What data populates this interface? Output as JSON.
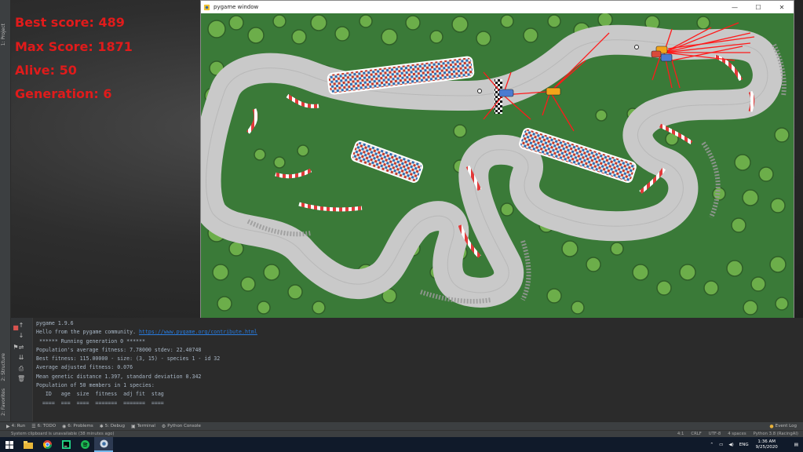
{
  "game_window": {
    "title": "pygame window",
    "minimize": "—",
    "maximize": "☐",
    "close": "✕"
  },
  "hud": {
    "best_score": "Best score: 489",
    "max_score": "Max Score: 1871",
    "alive": "Alive: 50",
    "generation": "Generation: 6"
  },
  "ide_left_tabs": [
    "1: Project",
    "2: Structure",
    "2: Favorites"
  ],
  "console": {
    "lines": [
      "pygame 1.9.6",
      "Hello from the pygame community. ",
      "",
      " ****** Running generation 0 ******",
      "",
      "Population's average fitness: 7.78000 stdev: 22.40748",
      "Best fitness: 115.00000 - size: (3, 15) - species 1 - id 32",
      "Average adjusted fitness: 0.076",
      "Mean genetic distance 1.397, standard deviation 0.342",
      "Population of 50 members in 1 species:",
      "   ID   age  size  fitness  adj fit  stag",
      "  ====  ===  ====  =======  =======  ===="
    ],
    "link": "https://www.pygame.org/contribute.html"
  },
  "toolbar": {
    "run": "4: Run",
    "todo": "6: TODO",
    "problems": "6: Problems",
    "debug": "5: Debug",
    "terminal": "Terminal",
    "python_console": "Python Console",
    "event_log": "Event Log"
  },
  "statusbar": {
    "message": "System clipboard is unavailable (38 minutes ago)",
    "position": "4:1",
    "line_sep": "CRLF",
    "encoding": "UTF-8",
    "indent": "4 spaces",
    "interpreter": "Python 3.8 (RacingAI)"
  },
  "taskbar": {
    "language": "ENG",
    "time": "1:36 AM",
    "date": "9/25/2020"
  },
  "colors": {
    "hud_red": "#e01b1b",
    "grass": "#3a7a38",
    "track": "#c8c8c8",
    "sensor": "#ff1a1a"
  }
}
